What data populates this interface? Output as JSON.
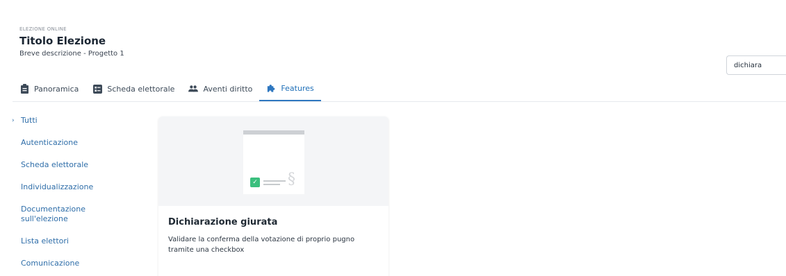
{
  "header": {
    "eyebrow": "ELEZIONE ONLINE",
    "title": "Titolo Elezione",
    "subtitle": "Breve descrizione - Progetto 1"
  },
  "search": {
    "value": "dichiara"
  },
  "tabs": [
    {
      "label": "Panoramica",
      "icon": "clipboard-icon"
    },
    {
      "label": "Scheda elettorale",
      "icon": "ballot-icon"
    },
    {
      "label": "Aventi diritto",
      "icon": "people-icon"
    },
    {
      "label": "Features",
      "icon": "puzzle-icon",
      "active": true
    }
  ],
  "sidebar": {
    "items": [
      {
        "label": "Tutti"
      },
      {
        "label": "Autenticazione"
      },
      {
        "label": "Scheda elettorale"
      },
      {
        "label": "Individualizzazione"
      },
      {
        "label": "Documentazione sull'elezione"
      },
      {
        "label": "Lista elettori"
      },
      {
        "label": "Comunicazione"
      }
    ]
  },
  "card": {
    "title": "Dichiarazione giurata",
    "description": "Validare la conferma della votazione di proprio pugno tramite una checkbox",
    "illustration_symbol": "§",
    "check_symbol": "✓"
  },
  "colors": {
    "accent": "#2e77c0",
    "link": "#2f6ea9",
    "check_green": "#3bbf7e"
  }
}
